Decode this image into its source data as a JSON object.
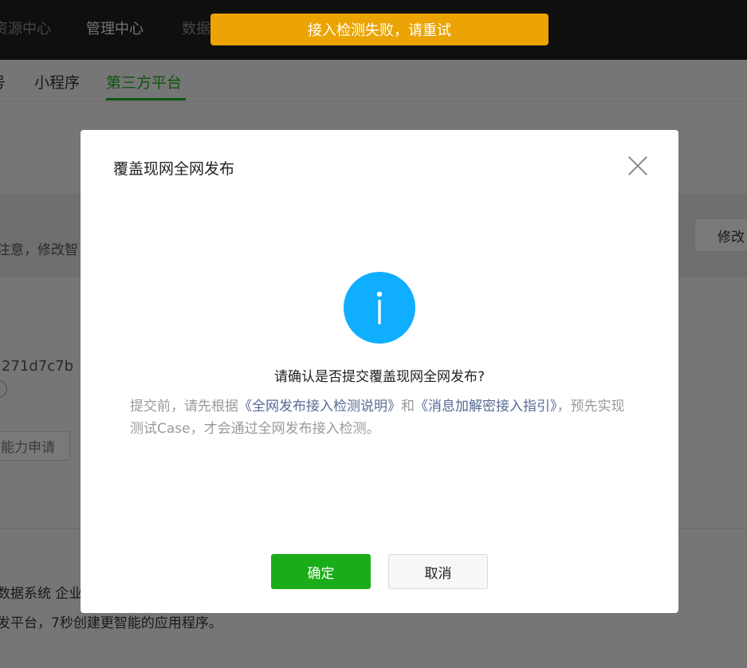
{
  "topnav": {
    "resources": "资源中心",
    "manage": "管理中心",
    "data": "数据"
  },
  "toast": {
    "message": "接入检测失败，请重试"
  },
  "subtabs": {
    "account": "号",
    "mini_program": "小程序",
    "third_party": "第三方平台"
  },
  "background": {
    "notice": "注意，修改智",
    "modify_button": "修改",
    "appid_partial": "271d7c7b",
    "apply_button": "能力申请",
    "text_line1": "数据系统 企业",
    "text_line2": "发平台，7秒创建更智能的应用程序。"
  },
  "dialog": {
    "title": "覆盖现网全网发布",
    "question": "请确认是否提交覆盖现网全网发布?",
    "desc_prefix": "提交前，请先根据",
    "link1": "《全网发布接入检测说明》",
    "desc_middle": "和",
    "link2": "《消息加解密接入指引》",
    "desc_suffix": "，预先实现测试Case，才会通过全网发布接入检测。",
    "confirm_label": "确定",
    "cancel_label": "取消"
  },
  "colors": {
    "brand_green": "#1aad19",
    "toast_orange": "#eba403",
    "info_blue": "#10aeff",
    "link_blue": "#576b95"
  }
}
